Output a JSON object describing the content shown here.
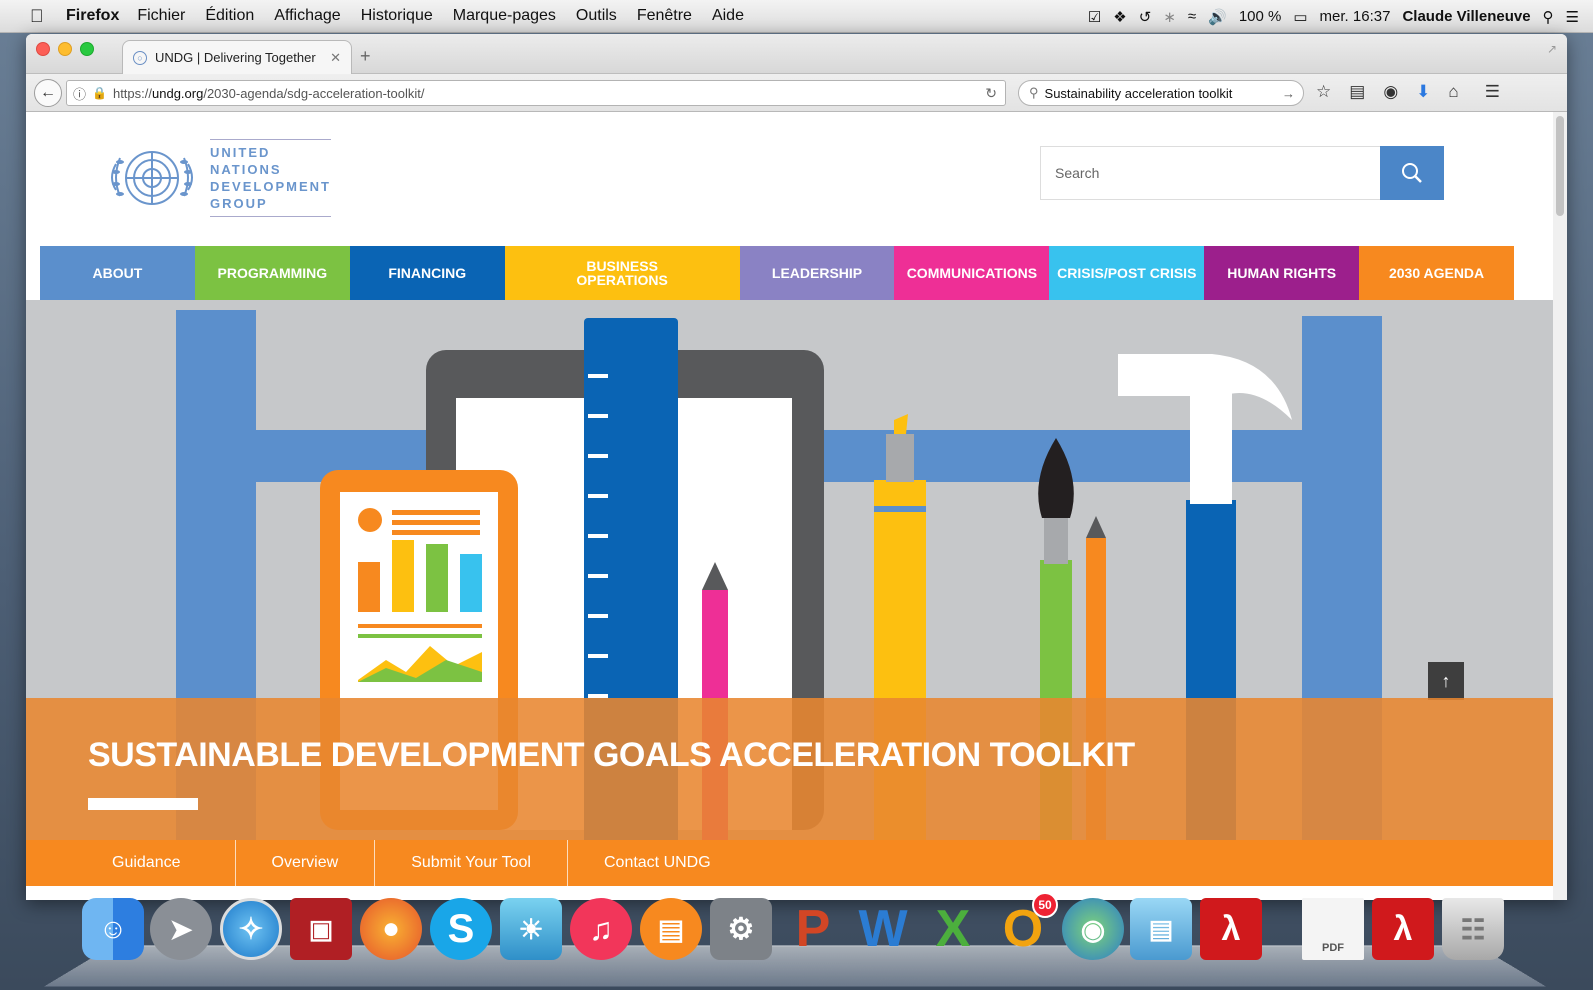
{
  "menubar": {
    "app_name": "Firefox",
    "items": [
      "Fichier",
      "Édition",
      "Affichage",
      "Historique",
      "Marque-pages",
      "Outils",
      "Fenêtre",
      "Aide"
    ],
    "battery": "100 %",
    "clock": "mer. 16:37",
    "user": "Claude Villeneuve"
  },
  "browser": {
    "tab_title": "UNDG | Delivering Together",
    "url_prefix": "https://",
    "url_domain": "undg.org",
    "url_path": "/2030-agenda/sdg-acceleration-toolkit/",
    "search_value": "Sustainability acceleration toolkit"
  },
  "site": {
    "logo_lines": [
      "UNITED",
      "NATIONS",
      "DEVELOPMENT",
      "GROUP"
    ],
    "search_placeholder": "Search",
    "nav": [
      {
        "label": "ABOUT",
        "color": "#5b8fcc"
      },
      {
        "label": "PROGRAMMING",
        "color": "#7cc242"
      },
      {
        "label": "FINANCING",
        "color": "#0a64b4"
      },
      {
        "label": "BUSINESS OPERATIONS",
        "color": "#fdc010"
      },
      {
        "label": "LEADERSHIP",
        "color": "#8a82c4"
      },
      {
        "label": "COMMUNICATIONS",
        "color": "#ee2f96"
      },
      {
        "label": "CRISIS/POST CRISIS",
        "color": "#38c2ee"
      },
      {
        "label": "HUMAN RIGHTS",
        "color": "#9c1f8c"
      },
      {
        "label": "2030 AGENDA",
        "color": "#f7891f"
      }
    ],
    "hero_title": "SUSTAINABLE DEVELOPMENT GOALS ACCELERATION TOOLKIT",
    "subnav": [
      "Guidance",
      "Overview",
      "Submit Your Tool",
      "Contact UNDG"
    ]
  },
  "dock": {
    "outlook_badge": "50",
    "pdf_label": "PDF"
  }
}
